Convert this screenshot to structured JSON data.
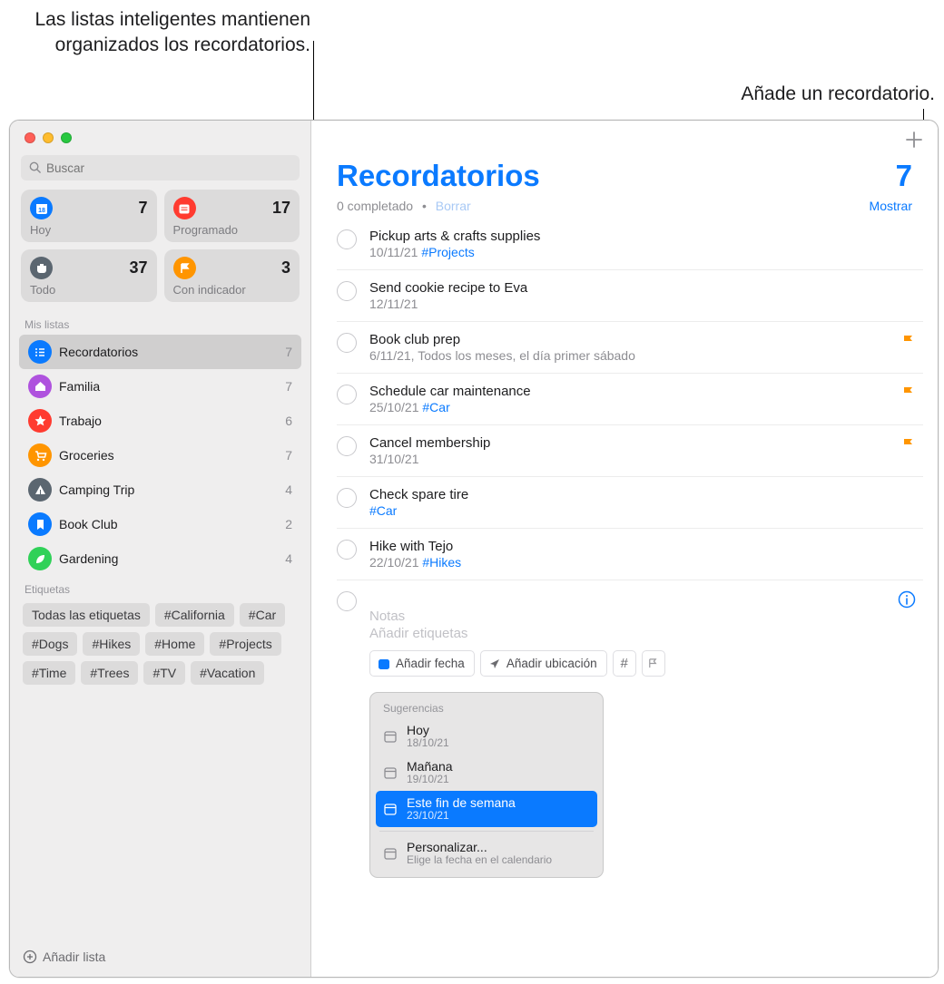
{
  "callouts": {
    "smart_lists": "Las listas inteligentes mantienen organizados los recordatorios.",
    "add_reminder": "Añade un recordatorio."
  },
  "search": {
    "placeholder": "Buscar"
  },
  "smart_cards": [
    {
      "label": "Hoy",
      "count": "7",
      "color": "#0a7aff"
    },
    {
      "label": "Programado",
      "count": "17",
      "color": "#ff3b30"
    },
    {
      "label": "Todo",
      "count": "37",
      "color": "#5b6670"
    },
    {
      "label": "Con indicador",
      "count": "3",
      "color": "#ff9500"
    }
  ],
  "sections": {
    "mylists": "Mis listas",
    "tags": "Etiquetas"
  },
  "lists": [
    {
      "label": "Recordatorios",
      "count": "7",
      "color": "#0a7aff",
      "icon": "list",
      "selected": true
    },
    {
      "label": "Familia",
      "count": "7",
      "color": "#af52de",
      "icon": "home"
    },
    {
      "label": "Trabajo",
      "count": "6",
      "color": "#ff3b30",
      "icon": "star"
    },
    {
      "label": "Groceries",
      "count": "7",
      "color": "#ff9500",
      "icon": "cart"
    },
    {
      "label": "Camping Trip",
      "count": "4",
      "color": "#5b6670",
      "icon": "tent"
    },
    {
      "label": "Book Club",
      "count": "2",
      "color": "#0a7aff",
      "icon": "bookmark"
    },
    {
      "label": "Gardening",
      "count": "4",
      "color": "#30d158",
      "icon": "leaf"
    }
  ],
  "tags": [
    "Todas las etiquetas",
    "#California",
    "#Car",
    "#Dogs",
    "#Hikes",
    "#Home",
    "#Projects",
    "#Time",
    "#Trees",
    "#TV",
    "#Vacation"
  ],
  "add_list": "Añadir lista",
  "main": {
    "title": "Recordatorios",
    "count": "7",
    "completed": "0 completado",
    "clear": "Borrar",
    "show": "Mostrar"
  },
  "reminders": [
    {
      "title": "Pickup arts & crafts supplies",
      "date": "10/11/21",
      "tag": "#Projects",
      "flagged": false
    },
    {
      "title": "Send cookie recipe to Eva",
      "date": "12/11/21",
      "tag": "",
      "flagged": false
    },
    {
      "title": "Book club prep",
      "date": "6/11/21, Todos los meses, el día primer sábado",
      "tag": "",
      "flagged": true
    },
    {
      "title": "Schedule car maintenance",
      "date": "25/10/21",
      "tag": "#Car",
      "flagged": true
    },
    {
      "title": "Cancel membership",
      "date": "31/10/21",
      "tag": "",
      "flagged": true
    },
    {
      "title": "Check spare tire",
      "date": "",
      "tag": "#Car",
      "flagged": false
    },
    {
      "title": "Hike with Tejo",
      "date": "22/10/21",
      "tag": "#Hikes",
      "flagged": false
    }
  ],
  "new_reminder": {
    "notes": "Notas",
    "add_tags": "Añadir etiquetas",
    "add_date": "Añadir fecha",
    "add_location": "Añadir ubicación"
  },
  "suggestions": {
    "header": "Sugerencias",
    "items": [
      {
        "title": "Hoy",
        "sub": "18/10/21",
        "selected": false
      },
      {
        "title": "Mañana",
        "sub": "19/10/21",
        "selected": false
      },
      {
        "title": "Este fin de semana",
        "sub": "23/10/21",
        "selected": true
      },
      {
        "title": "Personalizar...",
        "sub": "Elige la fecha en el calendario",
        "selected": false,
        "divider_before": true
      }
    ]
  }
}
